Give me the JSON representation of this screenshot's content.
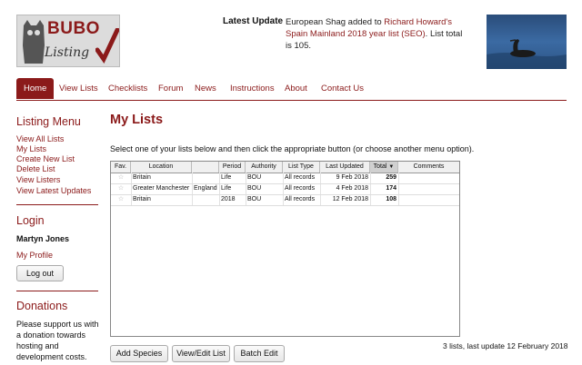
{
  "header": {
    "logo_title": "BUBO",
    "logo_subtitle": "Listing",
    "latest_update_label": "Latest Update",
    "latest_update_prefix": "European Shag added to ",
    "latest_update_link": "Richard Howard's Spain Mainland 2018 year list (SEO)",
    "latest_update_suffix": ". List total is 105."
  },
  "nav": {
    "items": [
      {
        "label": "Home",
        "active": true
      },
      {
        "label": "View Lists"
      },
      {
        "label": "Checklists"
      },
      {
        "label": "Forum"
      },
      {
        "label": "News"
      },
      {
        "label": "Instructions"
      },
      {
        "label": "About"
      },
      {
        "label": "Contact Us"
      }
    ]
  },
  "sidebar": {
    "listing_menu_title": "Listing Menu",
    "menu_links": [
      "View All Lists",
      "My Lists",
      "Create New List",
      "Delete List",
      "View Listers",
      "View Latest Updates"
    ],
    "login_title": "Login",
    "user_name": "Martyn Jones",
    "my_profile": "My Profile",
    "logout_label": "Log out",
    "donations_title": "Donations",
    "donations_text": "Please support us with a donation towards hosting and development costs."
  },
  "main": {
    "title": "My Lists",
    "intro": "Select one of your lists below and then click the appropriate button (or choose another menu option).",
    "table": {
      "columns": [
        "Fav.",
        "Location",
        "",
        "Period",
        "Authority",
        "List Type",
        "Last Updated",
        "Total",
        "Comments"
      ],
      "rows": [
        {
          "location": "Britain",
          "region": "",
          "period": "Life",
          "authority": "BOU",
          "list_type": "All records",
          "last_updated": "9 Feb 2018",
          "total": "259",
          "comments": ""
        },
        {
          "location": "Greater Manchester",
          "region": "England",
          "period": "Life",
          "authority": "BOU",
          "list_type": "All records",
          "last_updated": "4 Feb 2018",
          "total": "174",
          "comments": ""
        },
        {
          "location": "Britain",
          "region": "",
          "period": "2018",
          "authority": "BOU",
          "list_type": "All records",
          "last_updated": "12 Feb 2018",
          "total": "108",
          "comments": ""
        }
      ]
    },
    "buttons": {
      "add_species": "Add Species",
      "view_edit": "View/Edit List",
      "batch_edit": "Batch Edit"
    },
    "summary": "3 lists, last update 12 February 2018"
  },
  "colors": {
    "accent": "#8b1a1a"
  }
}
